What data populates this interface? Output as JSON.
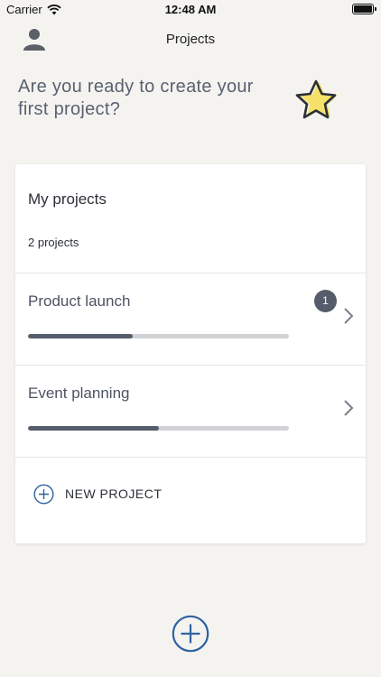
{
  "status_bar": {
    "carrier": "Carrier",
    "time": "12:48 AM"
  },
  "nav": {
    "title": "Projects",
    "profile_icon": "person-icon"
  },
  "prompt": {
    "text": "Are you ready to create your first project?",
    "icon": "star-icon"
  },
  "card": {
    "title": "My projects",
    "count_label": "2 projects",
    "projects": [
      {
        "name": "Product launch",
        "progress": 0.4,
        "badge": "1"
      },
      {
        "name": "Event planning",
        "progress": 0.5
      }
    ],
    "new_project_label": "NEW PROJECT"
  },
  "colors": {
    "background": "#f4f3f0",
    "accent_blue": "#2e62a0",
    "progress_fill": "#565e6c",
    "progress_track": "#d0d2d6",
    "star_fill": "#f6e16a"
  }
}
